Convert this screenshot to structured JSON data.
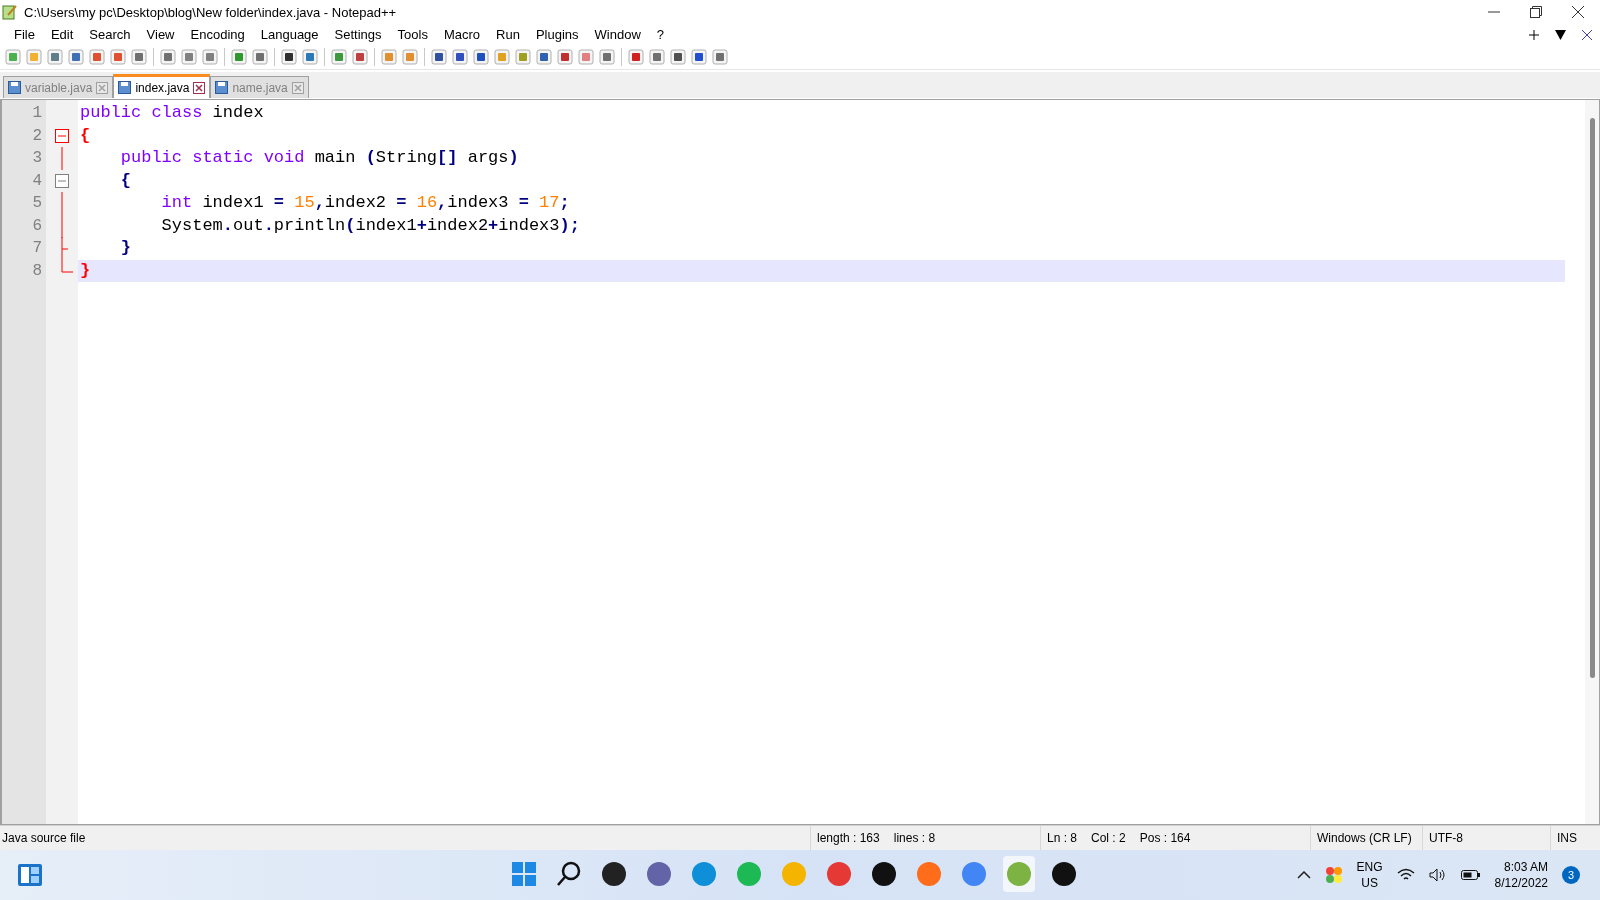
{
  "window": {
    "title": "C:\\Users\\my pc\\Desktop\\blog\\New folder\\index.java - Notepad++"
  },
  "menu": [
    "File",
    "Edit",
    "Search",
    "View",
    "Encoding",
    "Language",
    "Settings",
    "Tools",
    "Macro",
    "Run",
    "Plugins",
    "Window",
    "?"
  ],
  "tabs": [
    {
      "label": "variable.java",
      "selected": false
    },
    {
      "label": "index.java",
      "selected": true
    },
    {
      "label": "name.java",
      "selected": false
    }
  ],
  "editor": {
    "lines": [
      {
        "number": "1",
        "current": false,
        "tokens": [
          {
            "kind": "kw",
            "text": "public class"
          },
          {
            "kind": "id",
            "text": " index"
          }
        ]
      },
      {
        "number": "2",
        "fold": {
          "kind": "open",
          "active": true
        },
        "current": false,
        "tokens": [
          {
            "kind": "match",
            "text": "{"
          }
        ]
      },
      {
        "number": "3",
        "fold": {
          "kind": "line",
          "active": true
        },
        "current": false,
        "tokens": [
          {
            "kind": "kw",
            "text": "    public static void"
          },
          {
            "kind": "id",
            "text": " main "
          },
          {
            "kind": "op",
            "text": "("
          },
          {
            "kind": "id",
            "text": "String"
          },
          {
            "kind": "op",
            "text": "[]"
          },
          {
            "kind": "id",
            "text": " args"
          },
          {
            "kind": "op",
            "text": ")"
          }
        ]
      },
      {
        "number": "4",
        "fold": {
          "kind": "open",
          "active": false
        },
        "current": false,
        "tokens": [
          {
            "kind": "op",
            "text": "    {"
          }
        ]
      },
      {
        "number": "5",
        "fold": {
          "kind": "line",
          "active": true
        },
        "current": false,
        "tokens": [
          {
            "kind": "kw",
            "text": "        int"
          },
          {
            "kind": "id",
            "text": " index1 "
          },
          {
            "kind": "op",
            "text": "="
          },
          {
            "kind": "num",
            "text": " 15"
          },
          {
            "kind": "op",
            "text": ","
          },
          {
            "kind": "id",
            "text": "index2 "
          },
          {
            "kind": "op",
            "text": "="
          },
          {
            "kind": "num",
            "text": " 16"
          },
          {
            "kind": "op",
            "text": ","
          },
          {
            "kind": "id",
            "text": "index3 "
          },
          {
            "kind": "op",
            "text": "="
          },
          {
            "kind": "num",
            "text": " 17"
          },
          {
            "kind": "op",
            "text": ";"
          }
        ]
      },
      {
        "number": "6",
        "fold": {
          "kind": "line",
          "active": true
        },
        "current": false,
        "tokens": [
          {
            "kind": "id",
            "text": "        System"
          },
          {
            "kind": "op",
            "text": "."
          },
          {
            "kind": "id",
            "text": "out"
          },
          {
            "kind": "op",
            "text": "."
          },
          {
            "kind": "id",
            "text": "println"
          },
          {
            "kind": "op",
            "text": "("
          },
          {
            "kind": "id",
            "text": "index1"
          },
          {
            "kind": "op",
            "text": "+"
          },
          {
            "kind": "id",
            "text": "index2"
          },
          {
            "kind": "op",
            "text": "+"
          },
          {
            "kind": "id",
            "text": "index3"
          },
          {
            "kind": "op",
            "text": ");"
          }
        ]
      },
      {
        "number": "7",
        "fold": {
          "kind": "end",
          "active": true
        },
        "current": false,
        "tokens": [
          {
            "kind": "op",
            "text": "    }"
          }
        ]
      },
      {
        "number": "8",
        "fold": {
          "kind": "close",
          "active": true
        },
        "current": true,
        "tokens": [
          {
            "kind": "match",
            "text": "}"
          }
        ]
      }
    ]
  },
  "status_bar": {
    "file_type": "Java source file",
    "length": "length : 163",
    "lines": "lines : 8",
    "ln": "Ln : 8",
    "col": "Col : 2",
    "pos": "Pos : 164",
    "eol": "Windows (CR LF)",
    "encoding": "UTF-8",
    "mode": "INS"
  },
  "taskbar": {
    "language": "ENG",
    "region": "US",
    "time": "8:03 AM",
    "date": "8/12/2022",
    "notifications": "3"
  }
}
